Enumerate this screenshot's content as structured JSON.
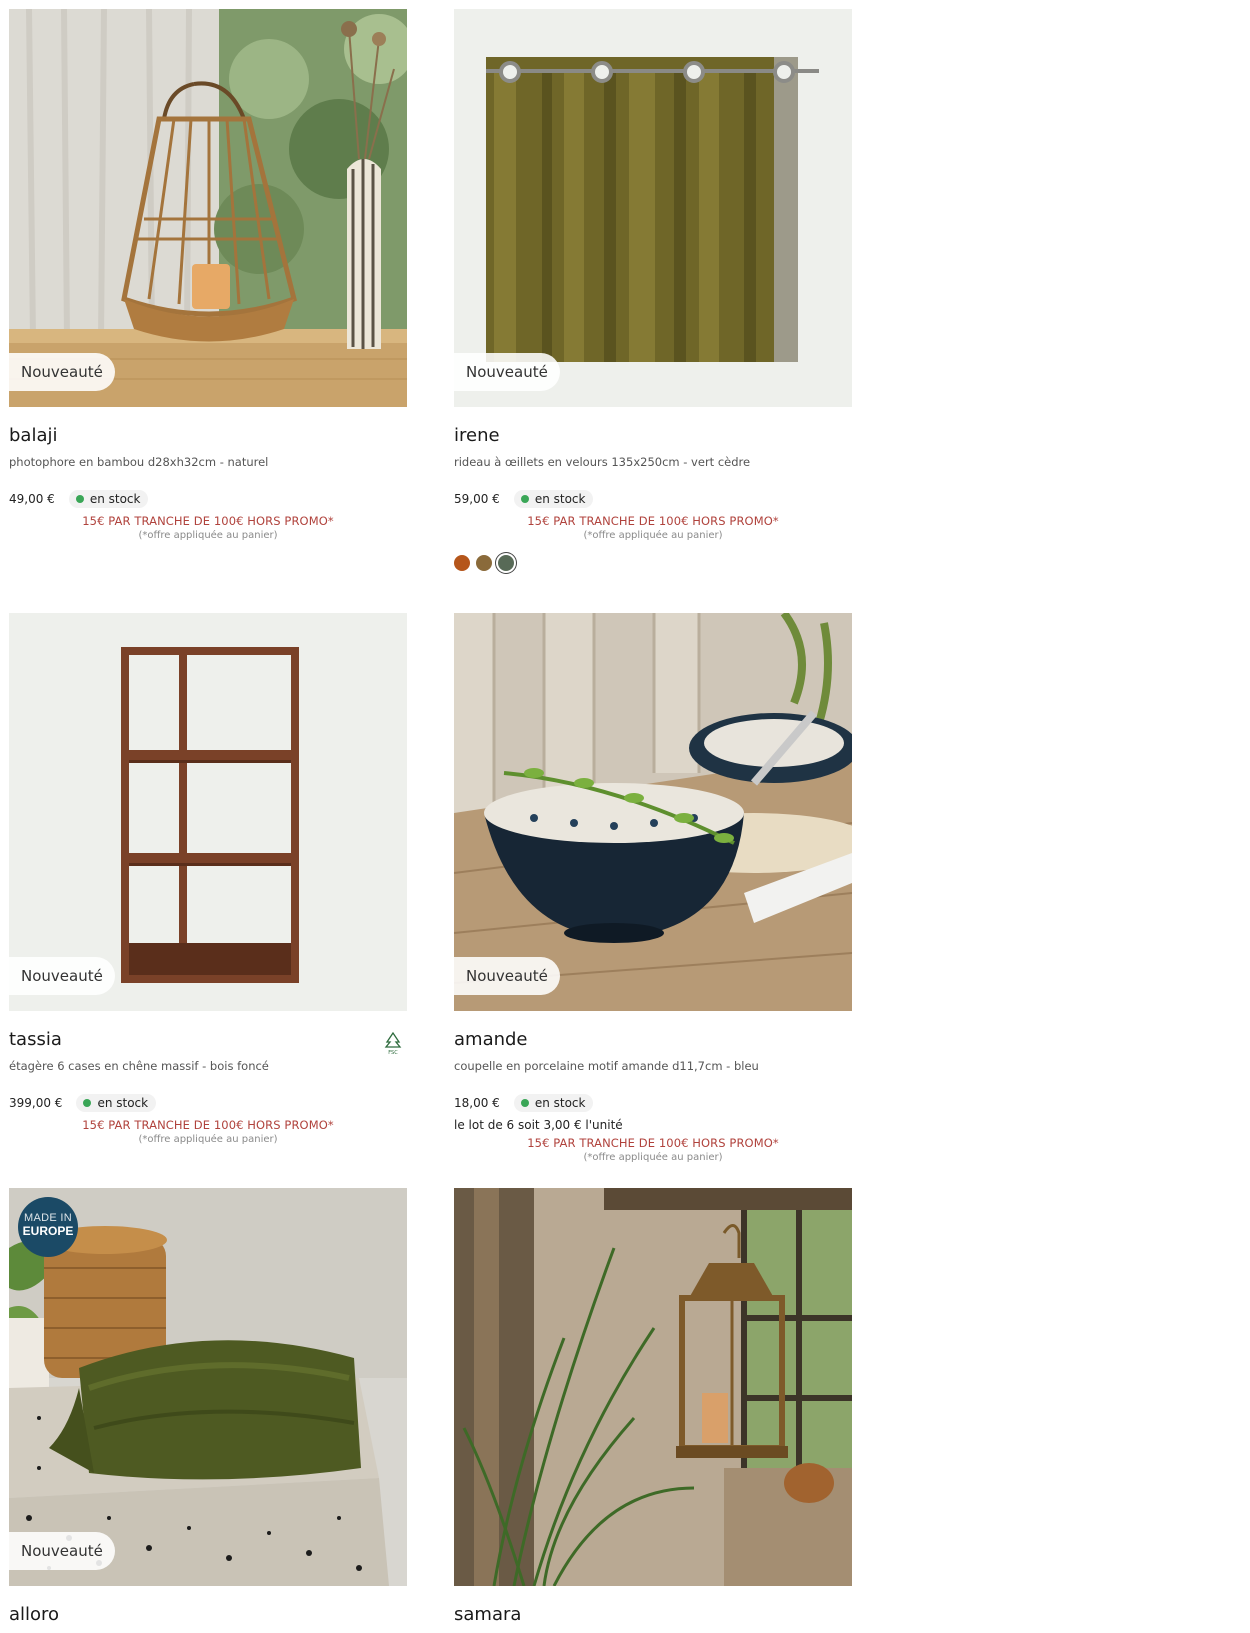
{
  "products": [
    {
      "badge": "Nouveauté",
      "name": "balaji",
      "desc": "photophore en bambou d28xh32cm - naturel",
      "price": "49,00 €",
      "stock": "en stock",
      "promo": "15€ PAR TRANCHE DE 100€ HORS PROMO*",
      "promo_note": "(*offre appliquée au panier)"
    },
    {
      "badge": "Nouveauté",
      "name": "irene",
      "desc": "rideau à œillets en velours 135x250cm - vert cèdre",
      "price": "59,00 €",
      "stock": "en stock",
      "promo": "15€ PAR TRANCHE DE 100€ HORS PROMO*",
      "promo_note": "(*offre appliquée au panier)",
      "swatches": [
        "#b5561b",
        "#8a6a3a",
        "#586a57"
      ]
    },
    {
      "badge": "Nouveauté",
      "name": "tassia",
      "desc": "étagère 6 cases en chêne massif - bois foncé",
      "price": "399,00 €",
      "stock": "en stock",
      "promo": "15€ PAR TRANCHE DE 100€ HORS PROMO*",
      "promo_note": "(*offre appliquée au panier)",
      "label_icon": "fsc-icon"
    },
    {
      "badge": "Nouveauté",
      "name": "amande",
      "desc": "coupelle en porcelaine motif amande d11,7cm - bleu",
      "price": "18,00 €",
      "stock": "en stock",
      "lot": "le lot de 6 soit 3,00 € l'unité",
      "promo": "15€ PAR TRANCHE DE 100€ HORS PROMO*",
      "promo_note": "(*offre appliquée au panier)"
    },
    {
      "badge": "Nouveauté",
      "name": "alloro",
      "made_in_1": "MADE IN",
      "made_in_2": "EUROPE"
    },
    {
      "name": "samara"
    }
  ],
  "colors": {
    "stock_dot": "#3aa657",
    "promo": "#b0423c"
  }
}
